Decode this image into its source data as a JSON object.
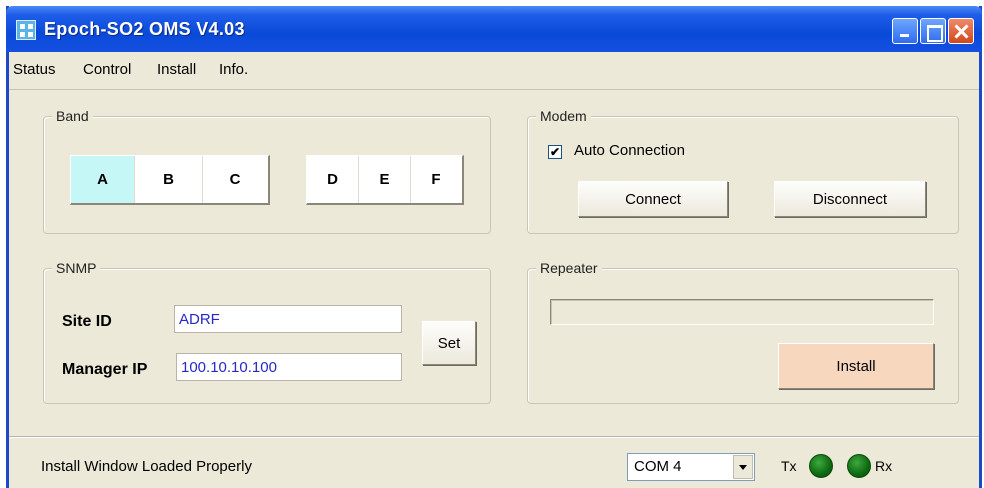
{
  "window": {
    "title": "Epoch-SO2 OMS V4.03"
  },
  "menu": [
    "Status",
    "Control",
    "Install",
    "Info."
  ],
  "band": {
    "label": "Band",
    "buttons": [
      "A",
      "B",
      "C",
      "D",
      "E",
      "F"
    ],
    "selected": "A",
    "selected_color": "#c6f7f7"
  },
  "modem": {
    "label": "Modem",
    "auto_connection_label": "Auto Connection",
    "auto_connection_checked": true,
    "connect_label": "Connect",
    "disconnect_label": "Disconnect"
  },
  "snmp": {
    "label": "SNMP",
    "site_id_label": "Site ID",
    "site_id_value": "ADRF",
    "manager_ip_label": "Manager IP",
    "manager_ip_value": "100.10.10.100",
    "set_label": "Set"
  },
  "repeater": {
    "label": "Repeater",
    "progress_text": "",
    "install_label": "Install",
    "install_color": "#f7d8bf"
  },
  "status": {
    "message": "Install Window Loaded Properly",
    "port": "COM 4",
    "tx_label": "Tx",
    "rx_label": "Rx",
    "led_color": "#0d6a12"
  }
}
